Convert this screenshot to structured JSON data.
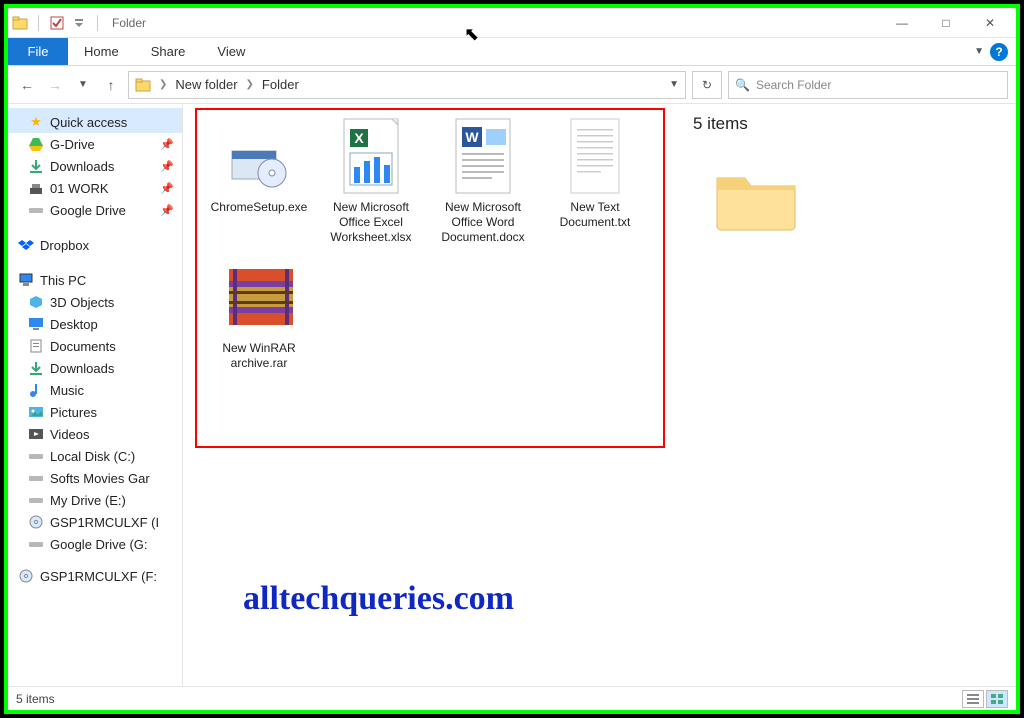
{
  "title_bar": {
    "window_title": "Folder"
  },
  "ribbon": {
    "file": "File",
    "tabs": [
      "Home",
      "Share",
      "View"
    ]
  },
  "breadcrumb": {
    "items": [
      "New folder",
      "Folder"
    ]
  },
  "search": {
    "placeholder": "Search Folder"
  },
  "item_count_top": "5 items",
  "nav": {
    "quick_access": "Quick access",
    "quick_items": [
      {
        "label": "G-Drive",
        "pinned": true,
        "icon": "gdrive"
      },
      {
        "label": "Downloads",
        "pinned": true,
        "icon": "downloads"
      },
      {
        "label": "01 WORK",
        "pinned": true,
        "icon": "folder-star"
      },
      {
        "label": "Google Drive",
        "pinned": true,
        "icon": "drive-disk"
      }
    ],
    "dropbox": "Dropbox",
    "this_pc": "This PC",
    "pc_items": [
      {
        "label": "3D Objects",
        "icon": "3d"
      },
      {
        "label": "Desktop",
        "icon": "desktop"
      },
      {
        "label": "Documents",
        "icon": "documents"
      },
      {
        "label": "Downloads",
        "icon": "downloads"
      },
      {
        "label": "Music",
        "icon": "music"
      },
      {
        "label": "Pictures",
        "icon": "pictures"
      },
      {
        "label": "Videos",
        "icon": "videos"
      },
      {
        "label": "Local Disk (C:)",
        "icon": "disk"
      },
      {
        "label": "Softs Movies Gar",
        "icon": "disk"
      },
      {
        "label": "My Drive (E:)",
        "icon": "disk"
      },
      {
        "label": "GSP1RMCULXF (I",
        "icon": "cd"
      },
      {
        "label": "Google Drive (G:",
        "icon": "disk"
      }
    ],
    "extra": {
      "label": "GSP1RMCULXF (F:",
      "icon": "cd"
    }
  },
  "files": [
    {
      "name": "ChromeSetup.exe",
      "icon": "chrome-installer"
    },
    {
      "name": "New Microsoft Office Excel Worksheet.xlsx",
      "icon": "excel"
    },
    {
      "name": "New Microsoft Office Word Document.docx",
      "icon": "word"
    },
    {
      "name": "New Text Document.txt",
      "icon": "text"
    },
    {
      "name": "New WinRAR archive.rar",
      "icon": "rar"
    }
  ],
  "watermark": "alltechqueries.com",
  "status_bar": {
    "item_count": "5 items"
  }
}
